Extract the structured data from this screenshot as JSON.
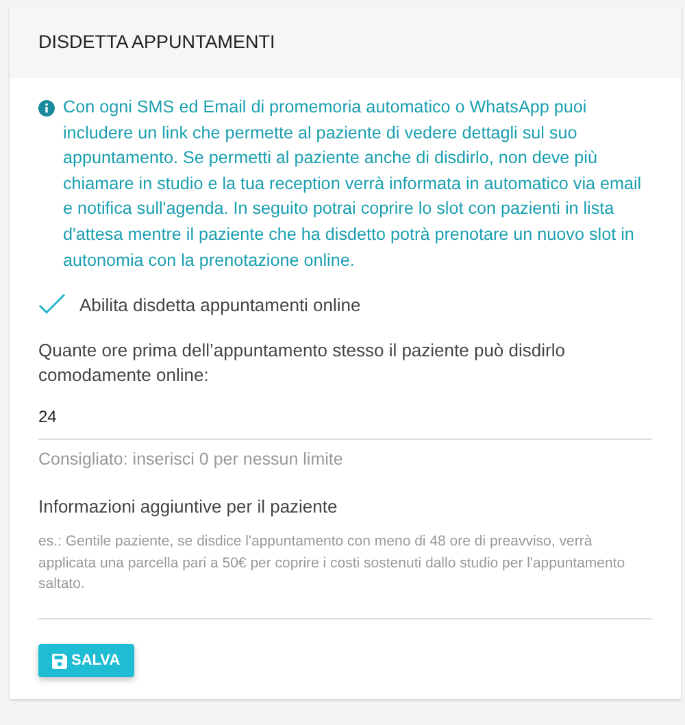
{
  "card": {
    "title": "DISDETTA APPUNTAMENTI"
  },
  "info": "Con ogni SMS ed Email di promemoria automatico o WhatsApp puoi includere un link che permette al paziente di vedere dettagli sul suo appuntamento. Se permetti al paziente anche di disdirlo, non deve più chiamare in studio e la tua reception verrà informata in automatico via email e notifica sull'agenda. In seguito potrai coprire lo slot con pazienti in lista d'attesa mentre il paziente che ha disdetto potrà prenotare un nuovo slot in autonomia con la prenotazione online.",
  "enable": {
    "label": "Abilita disdetta appuntamenti online",
    "checked": true
  },
  "hours": {
    "label": "Quante ore prima dell’appuntamento stesso il paziente può disdirlo comodamente online:",
    "value": "24",
    "hint": "Consigliato: inserisci 0 per nessun limite"
  },
  "extra": {
    "label": "Informazioni aggiuntive per il paziente",
    "placeholder": "es.: Gentile paziente, se disdice l'appuntamento con meno di 48 ore di preavviso, verrà applicata una parcella pari a 50€ per coprire i costi sostenuti dallo studio per l'appuntamento saltato."
  },
  "save_button": "SALVA"
}
